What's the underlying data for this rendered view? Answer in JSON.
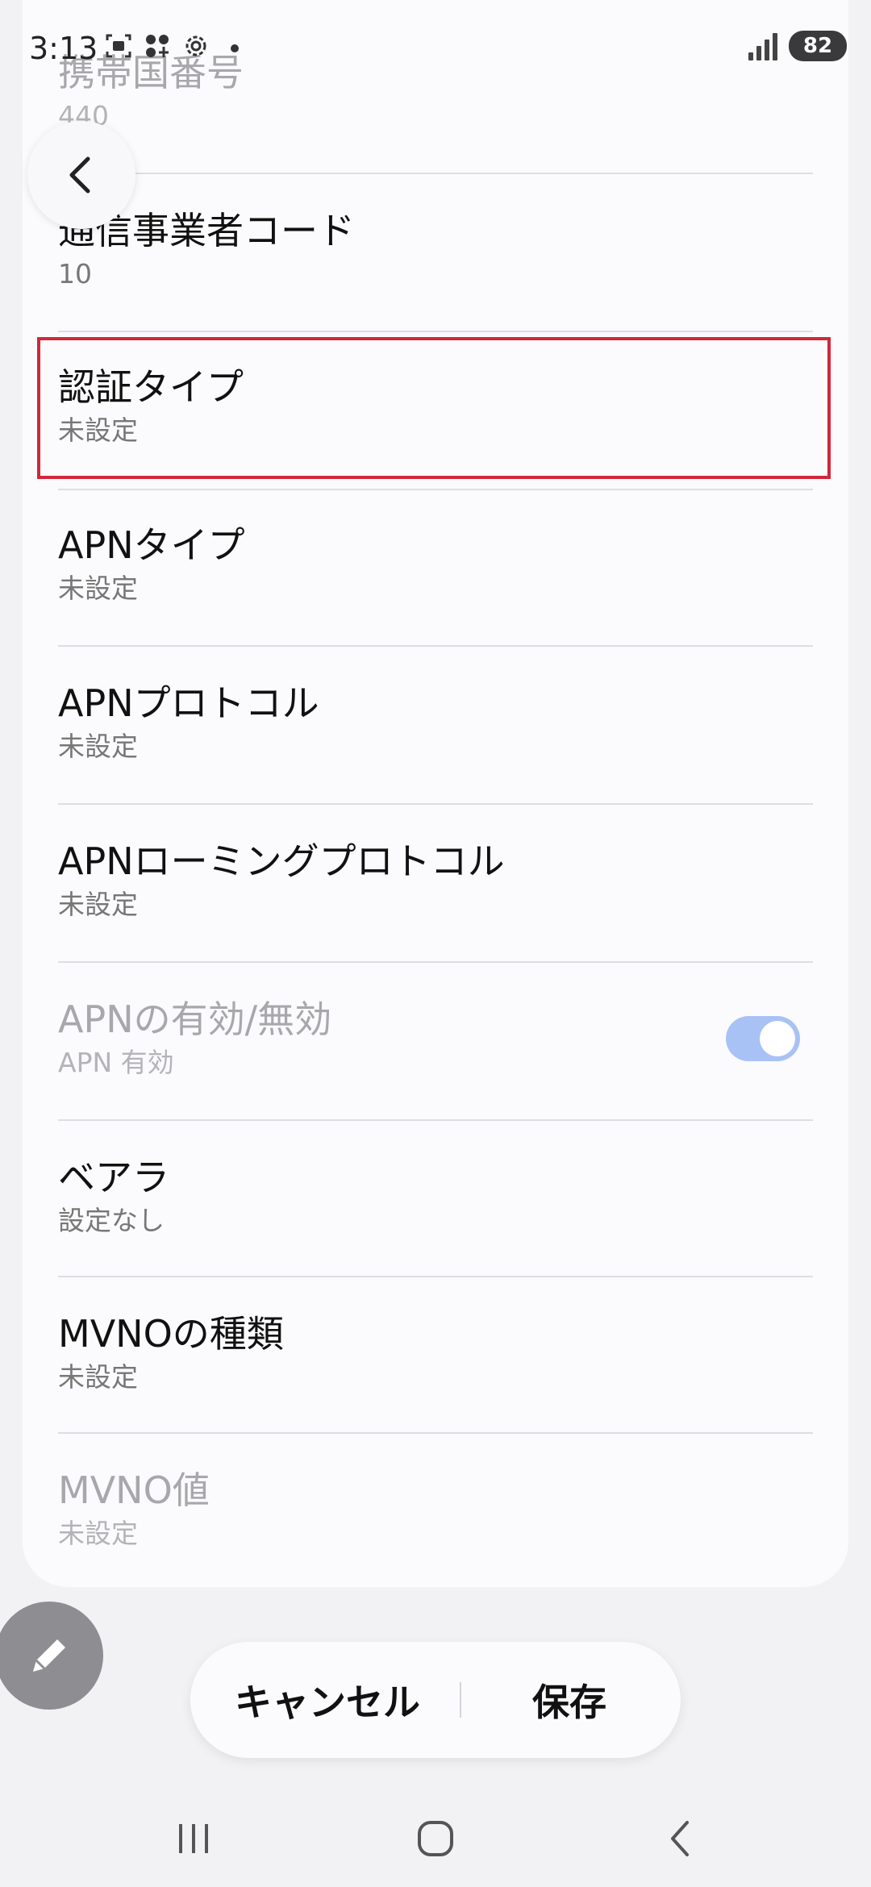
{
  "status_bar": {
    "time": "3:13",
    "battery": "82"
  },
  "rows": [
    {
      "title": "携帯国番号",
      "value": "440",
      "disabled": true
    },
    {
      "title": "通信事業者コード",
      "value": "10"
    },
    {
      "title": "認証タイプ",
      "value": "未設定"
    },
    {
      "title": "APNタイプ",
      "value": "未設定"
    },
    {
      "title": "APNプロトコル",
      "value": "未設定"
    },
    {
      "title": "APNローミングプロトコル",
      "value": "未設定"
    },
    {
      "title": "APNの有効/無効",
      "value": "APN 有効",
      "disabled": true
    },
    {
      "title": "ベアラ",
      "value": "設定なし"
    },
    {
      "title": "MVNOの種類",
      "value": "未設定"
    },
    {
      "title": "MVNO値",
      "value": "未設定",
      "disabled": true
    }
  ],
  "actions": {
    "cancel": "キャンセル",
    "save": "保存"
  },
  "colors": {
    "highlight": "#d0283a",
    "toggle_on": "#a9c2f5"
  }
}
